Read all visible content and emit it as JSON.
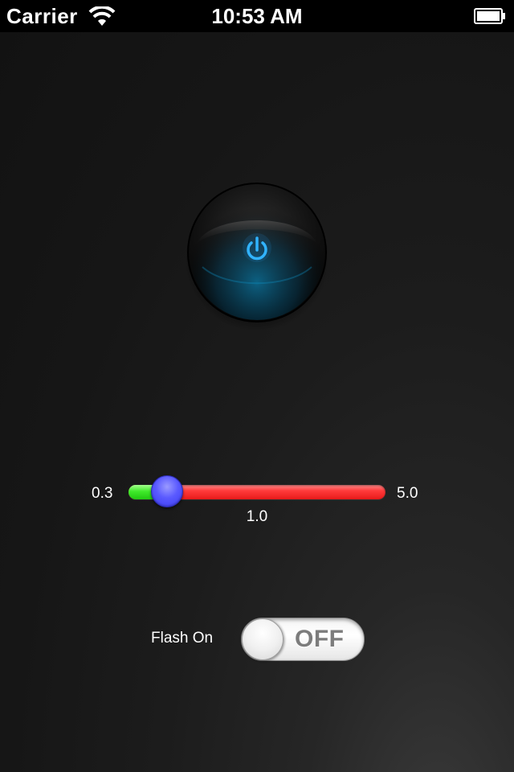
{
  "status_bar": {
    "carrier": "Carrier",
    "time": "10:53 AM",
    "wifi_icon": "wifi-icon",
    "battery_icon": "battery-full-icon"
  },
  "power_button": {
    "icon": "power-icon",
    "glow_color": "#2aa8ff"
  },
  "slider": {
    "min_label": "0.3",
    "max_label": "5.0",
    "value_label": "1.0",
    "min": 0.3,
    "max": 5.0,
    "value": 1.0,
    "fill_color": "#3fea2a",
    "track_color": "#ff3b3b",
    "thumb_color": "#5a5aff"
  },
  "flash": {
    "label": "Flash On",
    "switch_state": "OFF"
  }
}
